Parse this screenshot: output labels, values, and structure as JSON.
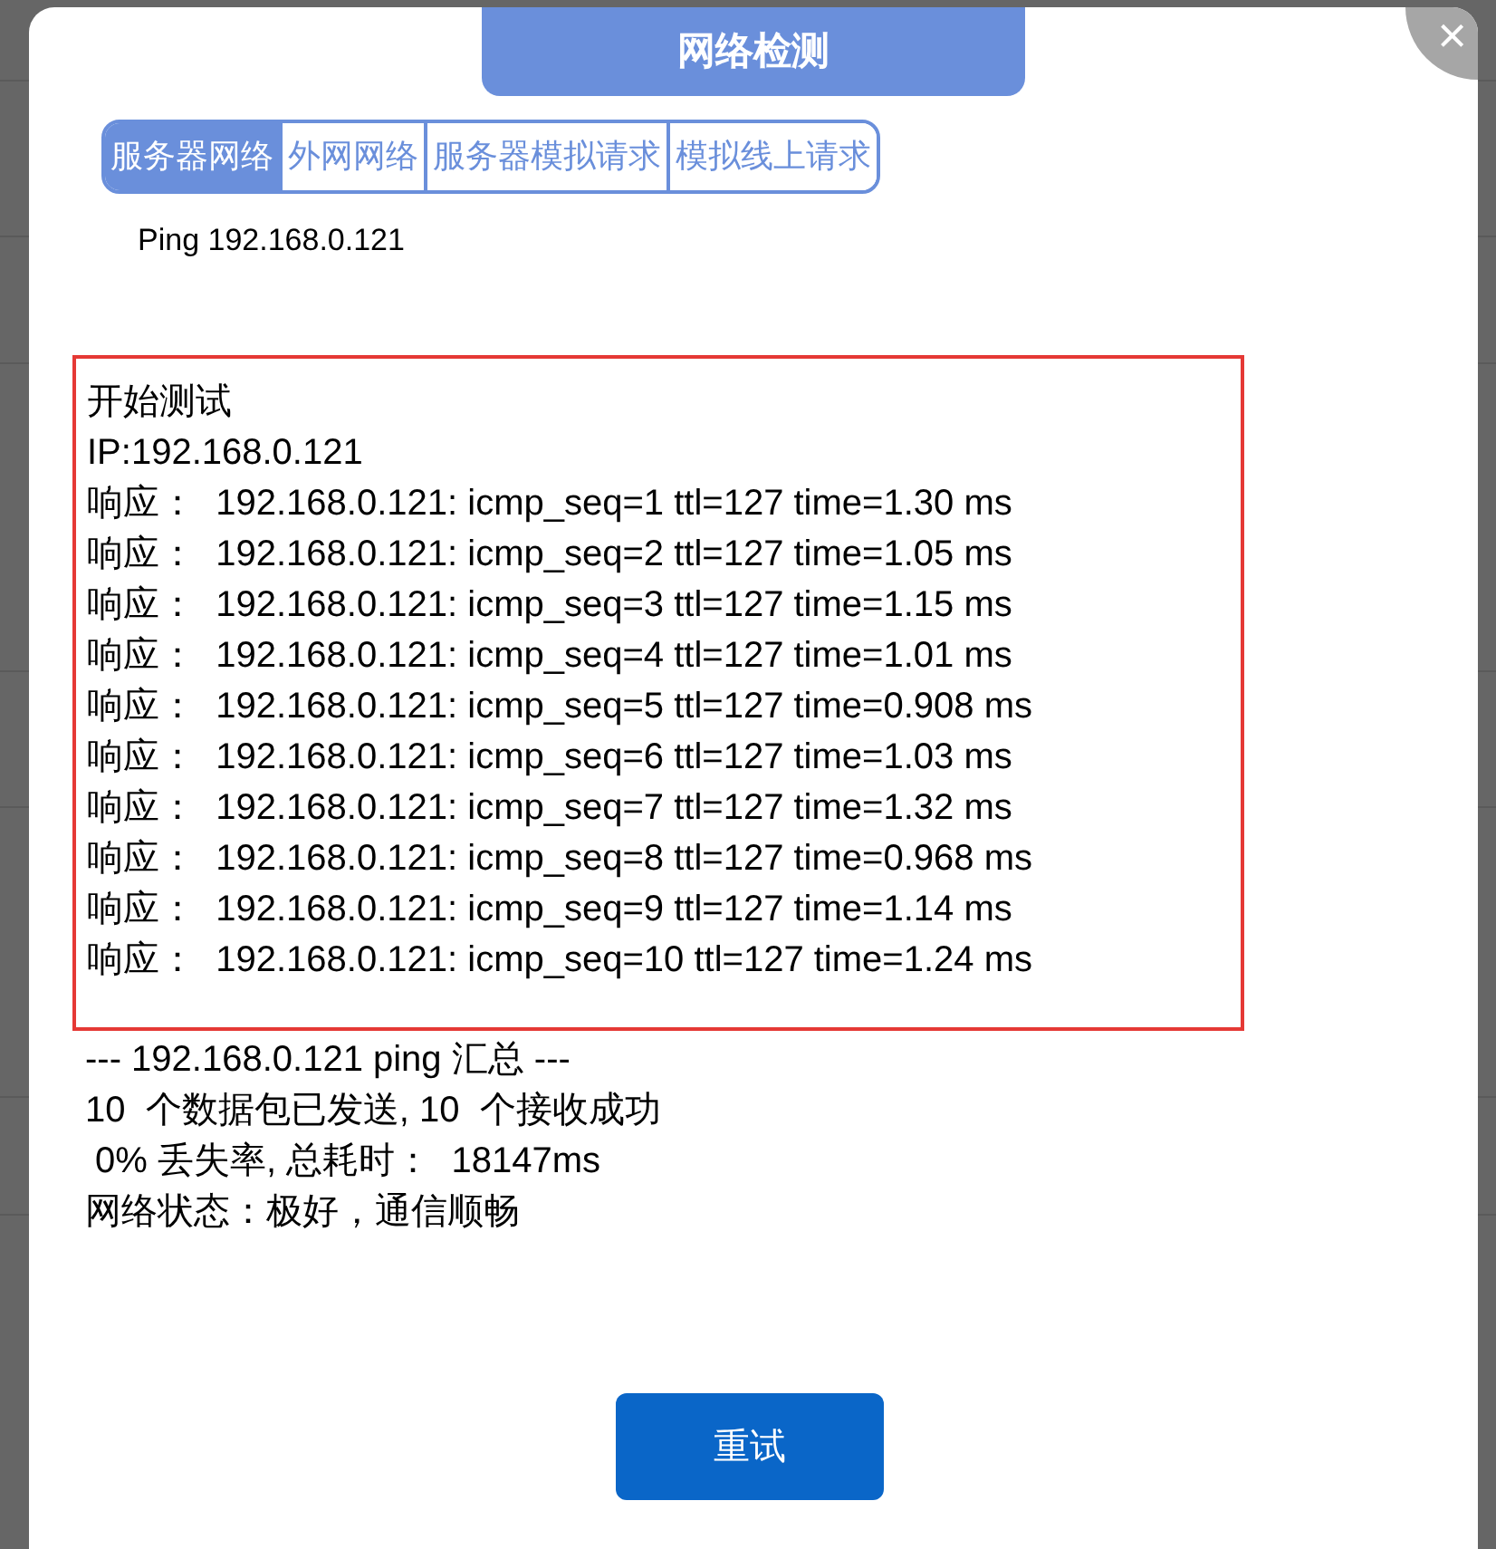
{
  "dialog": {
    "title": "网络检测",
    "close": "×"
  },
  "tabs": [
    {
      "label": "服务器网络",
      "selected": true
    },
    {
      "label": "外网网络",
      "selected": false
    },
    {
      "label": "服务器模拟请求",
      "selected": false
    },
    {
      "label": "模拟线上请求",
      "selected": false
    }
  ],
  "target": "Ping 192.168.0.121",
  "log": [
    "开始测试",
    "IP:192.168.0.121",
    "响应：  192.168.0.121: icmp_seq=1 ttl=127 time=1.30 ms",
    "响应：  192.168.0.121: icmp_seq=2 ttl=127 time=1.05 ms",
    "响应：  192.168.0.121: icmp_seq=3 ttl=127 time=1.15 ms",
    "响应：  192.168.0.121: icmp_seq=4 ttl=127 time=1.01 ms",
    "响应：  192.168.0.121: icmp_seq=5 ttl=127 time=0.908 ms",
    "响应：  192.168.0.121: icmp_seq=6 ttl=127 time=1.03 ms",
    "响应：  192.168.0.121: icmp_seq=7 ttl=127 time=1.32 ms",
    "响应：  192.168.0.121: icmp_seq=8 ttl=127 time=0.968 ms",
    "响应：  192.168.0.121: icmp_seq=9 ttl=127 time=1.14 ms",
    "响应：  192.168.0.121: icmp_seq=10 ttl=127 time=1.24 ms"
  ],
  "summary": [
    "--- 192.168.0.121 ping 汇总 ---",
    "10  个数据包已发送, 10  个接收成功",
    " 0% 丢失率, 总耗时：  18147ms",
    "网络状态：极好，通信顺畅"
  ],
  "retry_button": "重试"
}
